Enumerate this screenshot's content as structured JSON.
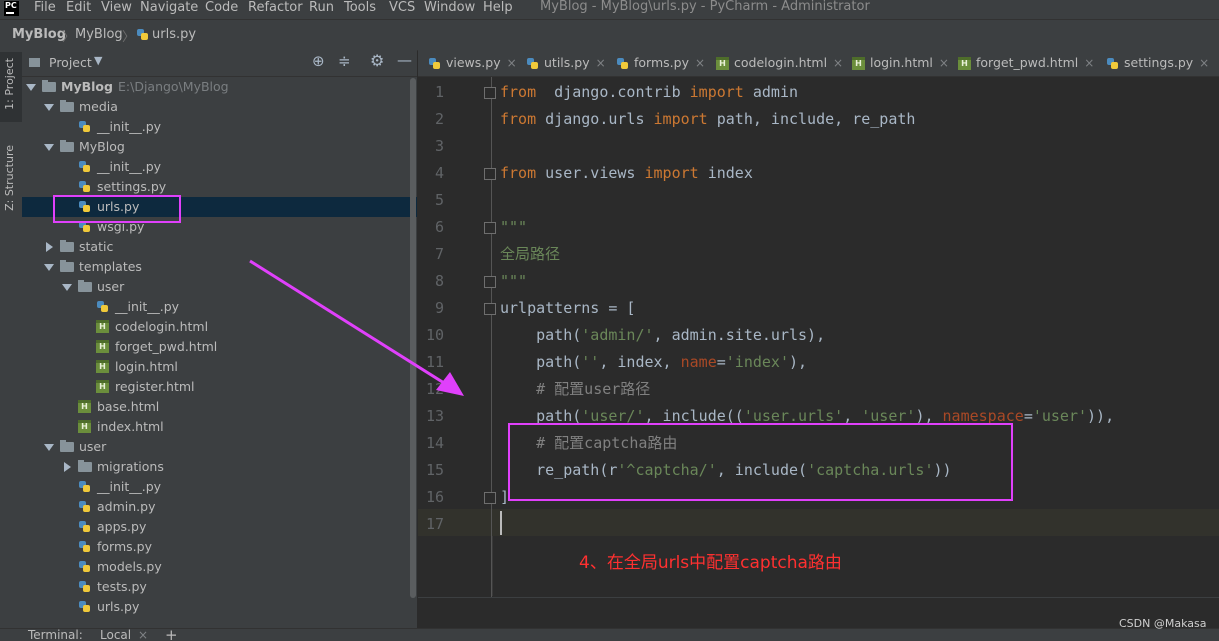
{
  "app": {
    "logo": "PC",
    "window_title": "MyBlog - MyBlog\\urls.py - PyCharm - Administrator"
  },
  "menu": [
    "File",
    "Edit",
    "View",
    "Navigate",
    "Code",
    "Refactor",
    "Run",
    "Tools",
    "VCS",
    "Window",
    "Help"
  ],
  "breadcrumb": [
    "MyBlog",
    "MyBlog",
    "urls.py"
  ],
  "toolstrip": {
    "project_tab": "1: Project",
    "structure_tab": "Z: Structure"
  },
  "project_panel": {
    "title": "Project",
    "tree": [
      {
        "label": "MyBlog",
        "path": "E:\\Django\\MyBlog",
        "type": "root",
        "depth": 0,
        "expanded": true
      },
      {
        "label": "media",
        "type": "folder",
        "depth": 1,
        "expanded": true
      },
      {
        "label": "__init__.py",
        "type": "py",
        "depth": 2
      },
      {
        "label": "MyBlog",
        "type": "folder",
        "depth": 1,
        "expanded": true
      },
      {
        "label": "__init__.py",
        "type": "py",
        "depth": 2
      },
      {
        "label": "settings.py",
        "type": "py",
        "depth": 2
      },
      {
        "label": "urls.py",
        "type": "py",
        "depth": 2,
        "selected": true
      },
      {
        "label": "wsgi.py",
        "type": "py",
        "depth": 2
      },
      {
        "label": "static",
        "type": "folder",
        "depth": 1,
        "expanded": false
      },
      {
        "label": "templates",
        "type": "folder",
        "depth": 1,
        "expanded": true
      },
      {
        "label": "user",
        "type": "folder",
        "depth": 2,
        "expanded": true
      },
      {
        "label": "__init__.py",
        "type": "py",
        "depth": 3
      },
      {
        "label": "codelogin.html",
        "type": "html",
        "depth": 3
      },
      {
        "label": "forget_pwd.html",
        "type": "html",
        "depth": 3
      },
      {
        "label": "login.html",
        "type": "html",
        "depth": 3
      },
      {
        "label": "register.html",
        "type": "html",
        "depth": 3
      },
      {
        "label": "base.html",
        "type": "html",
        "depth": 2
      },
      {
        "label": "index.html",
        "type": "html",
        "depth": 2
      },
      {
        "label": "user",
        "type": "folder",
        "depth": 1,
        "expanded": true
      },
      {
        "label": "migrations",
        "type": "folder",
        "depth": 2,
        "expanded": false
      },
      {
        "label": "__init__.py",
        "type": "py",
        "depth": 2
      },
      {
        "label": "admin.py",
        "type": "py",
        "depth": 2
      },
      {
        "label": "apps.py",
        "type": "py",
        "depth": 2
      },
      {
        "label": "forms.py",
        "type": "py",
        "depth": 2
      },
      {
        "label": "models.py",
        "type": "py",
        "depth": 2
      },
      {
        "label": "tests.py",
        "type": "py",
        "depth": 2
      },
      {
        "label": "urls.py",
        "type": "py",
        "depth": 2
      }
    ]
  },
  "editor_tabs": [
    {
      "label": "views.py",
      "type": "py"
    },
    {
      "label": "utils.py",
      "type": "py"
    },
    {
      "label": "forms.py",
      "type": "py"
    },
    {
      "label": "codelogin.html",
      "type": "html"
    },
    {
      "label": "login.html",
      "type": "html"
    },
    {
      "label": "forget_pwd.html",
      "type": "html"
    },
    {
      "label": "settings.py",
      "type": "py"
    }
  ],
  "code_lines": [
    {
      "n": "1",
      "tokens": [
        [
          "kw",
          "from"
        ],
        [
          "",
          "  django.contrib "
        ],
        [
          "kw",
          "import"
        ],
        [
          "",
          " admin"
        ]
      ]
    },
    {
      "n": "2",
      "tokens": [
        [
          "kw",
          "from"
        ],
        [
          "",
          " django.urls "
        ],
        [
          "kw",
          "import"
        ],
        [
          "",
          " path, include, re_path"
        ]
      ]
    },
    {
      "n": "3",
      "tokens": []
    },
    {
      "n": "4",
      "tokens": [
        [
          "kw",
          "from"
        ],
        [
          "",
          " user.views "
        ],
        [
          "kw",
          "import"
        ],
        [
          "",
          " index"
        ]
      ]
    },
    {
      "n": "5",
      "tokens": []
    },
    {
      "n": "6",
      "tokens": [
        [
          "str",
          "\"\"\""
        ]
      ]
    },
    {
      "n": "7",
      "tokens": [
        [
          "zh",
          "全局路径"
        ]
      ]
    },
    {
      "n": "8",
      "tokens": [
        [
          "str",
          "\"\"\""
        ]
      ]
    },
    {
      "n": "9",
      "tokens": [
        [
          "",
          "urlpatterns = ["
        ]
      ]
    },
    {
      "n": "10",
      "tokens": [
        [
          "",
          "    path("
        ],
        [
          "str",
          "'admin/'"
        ],
        [
          "",
          ", admin.site.urls),"
        ]
      ]
    },
    {
      "n": "11",
      "tokens": [
        [
          "",
          "    path("
        ],
        [
          "str",
          "''"
        ],
        [
          "",
          ", index, "
        ],
        [
          "nm",
          "name"
        ],
        [
          "",
          "="
        ],
        [
          "str",
          "'index'"
        ],
        [
          "",
          "),"
        ]
      ]
    },
    {
      "n": "12",
      "tokens": [
        [
          "cmt",
          "    # 配置user路径"
        ]
      ]
    },
    {
      "n": "13",
      "tokens": [
        [
          "",
          "    path("
        ],
        [
          "str",
          "'user/'"
        ],
        [
          "",
          ", include(("
        ],
        [
          "str",
          "'user.urls'"
        ],
        [
          "",
          ", "
        ],
        [
          "str",
          "'user'"
        ],
        [
          "",
          "), "
        ],
        [
          "nm",
          "namespace"
        ],
        [
          "",
          "="
        ],
        [
          "str",
          "'user'"
        ],
        [
          "",
          ")),"
        ]
      ]
    },
    {
      "n": "14",
      "tokens": [
        [
          "cmt",
          "    # 配置captcha路由"
        ]
      ]
    },
    {
      "n": "15",
      "tokens": [
        [
          "",
          "    re_path(r"
        ],
        [
          "str",
          "'^captcha/'"
        ],
        [
          "",
          ", include("
        ],
        [
          "str",
          "'captcha.urls'"
        ],
        [
          "",
          "))"
        ]
      ]
    },
    {
      "n": "16",
      "tokens": [
        [
          "",
          "]"
        ]
      ]
    },
    {
      "n": "17",
      "tokens": []
    }
  ],
  "annotation": "4、在全局urls中配置captcha路由",
  "terminal": {
    "label": "Terminal:",
    "tab": "Local",
    "add": "+"
  },
  "watermark": "CSDN @Makasa",
  "colors": {
    "highlight": "#e040fb",
    "annotation": "#ff3030",
    "keyword": "#cc7832",
    "string": "#6a8759",
    "comment": "#808080"
  }
}
